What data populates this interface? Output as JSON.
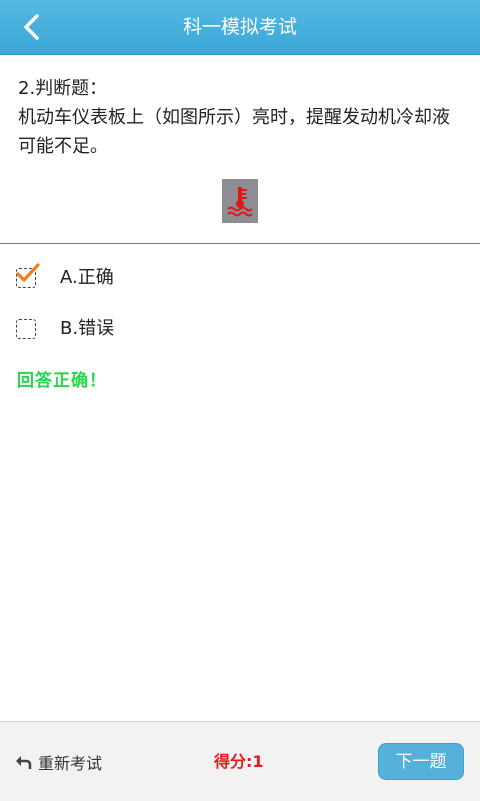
{
  "header": {
    "title": "科一模拟考试",
    "back_icon": "chevron-left-icon"
  },
  "question": {
    "type_label": "2.判断题：",
    "text": "机动车仪表板上（如图所示）亮时，提醒发动机冷却液可能不足。",
    "image_icon": "coolant-temperature-warning-icon"
  },
  "options": [
    {
      "label": "A.正确",
      "checked": true
    },
    {
      "label": "B.错误",
      "checked": false
    }
  ],
  "result": "回答正确！",
  "footer": {
    "restart_label": "重新考试",
    "score_label": "得分:1",
    "next_label": "下一题"
  },
  "colors": {
    "accent": "#3aa7d8",
    "correct": "#27d84a",
    "score": "#e31b1b",
    "check": "#f07d1e"
  }
}
